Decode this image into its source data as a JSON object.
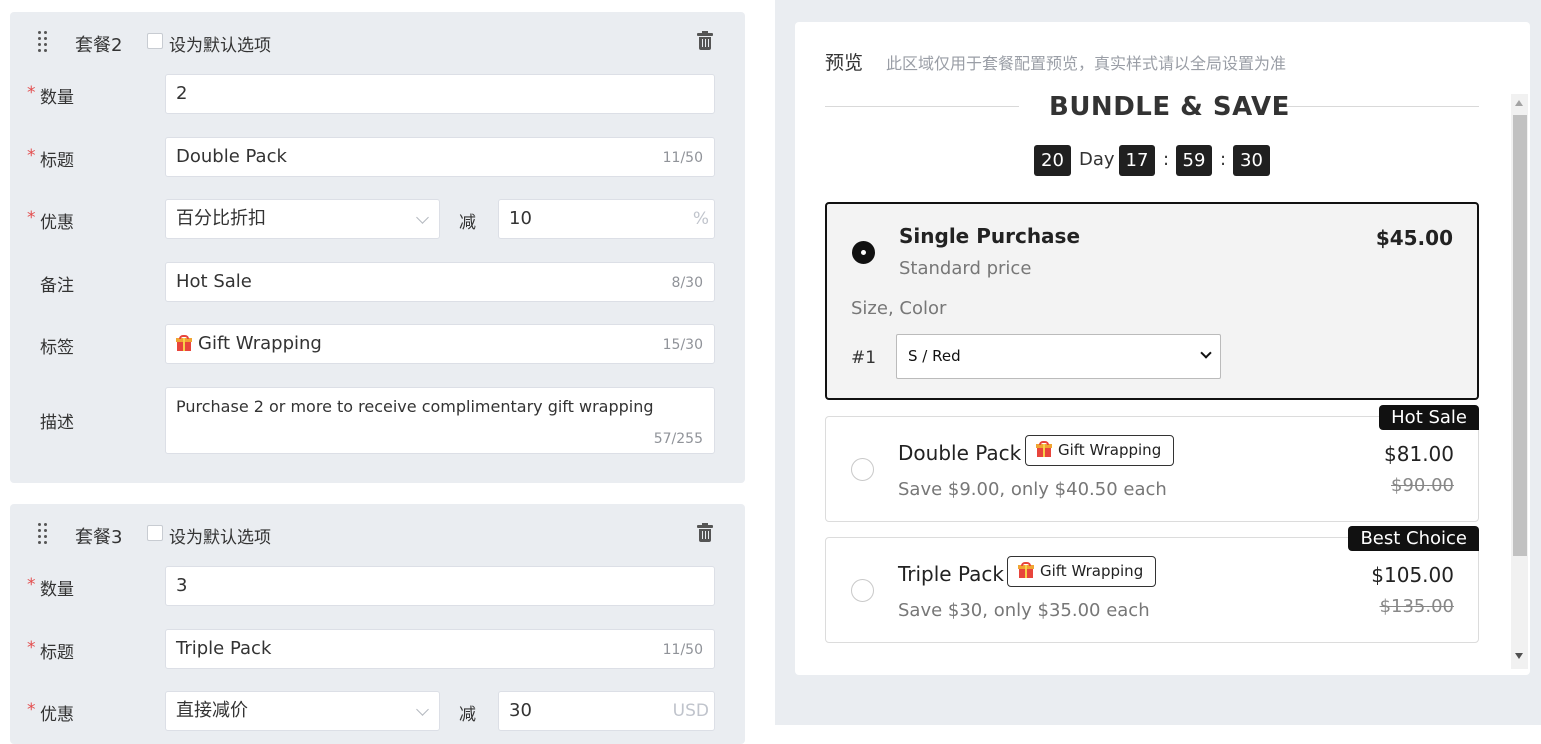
{
  "colors": {
    "required": "#e34d4d",
    "panel": "#eaedf1",
    "accent": "#111111"
  },
  "card2": {
    "title": "套餐2",
    "default_label": "设为默认选项",
    "fields": {
      "quantity": {
        "label": "数量",
        "value": "2"
      },
      "title": {
        "label": "标题",
        "value": "Double Pack",
        "count": "11/50"
      },
      "discount": {
        "label": "优惠",
        "type": "百分比折扣",
        "minus": "减",
        "value": "10",
        "unit": "%"
      },
      "note": {
        "label": "备注",
        "value": "Hot Sale",
        "count": "8/30"
      },
      "tag": {
        "label": "标签",
        "icon": "gift-icon",
        "value": "Gift Wrapping",
        "count": "15/30"
      },
      "desc": {
        "label": "描述",
        "value": "Purchase 2 or more to receive complimentary gift wrapping",
        "count": "57/255"
      }
    }
  },
  "card3": {
    "title": "套餐3",
    "default_label": "设为默认选项",
    "fields": {
      "quantity": {
        "label": "数量",
        "value": "3"
      },
      "title": {
        "label": "标题",
        "value": "Triple Pack",
        "count": "11/50"
      },
      "discount": {
        "label": "优惠",
        "type": "直接减价",
        "minus": "减",
        "value": "30",
        "unit": "USD"
      }
    }
  },
  "preview": {
    "title": "预览",
    "note": "此区域仅用于套餐配置预览，真实样式请以全局设置为准",
    "heading": "BUNDLE & SAVE",
    "timer": {
      "days": "20",
      "day_label": "Day",
      "hours": "17",
      "minutes": "59",
      "seconds": "30",
      "sep": ":"
    },
    "options": [
      {
        "name": "Single Purchase",
        "sub": "Standard price",
        "price": "$45.00",
        "attr_label": "Size, Color",
        "index": "#1",
        "variant": "S / Red",
        "selected": true
      },
      {
        "name": "Double Pack",
        "tag": "Gift Wrapping",
        "sub": "Save $9.00, only $40.50 each",
        "price": "$81.00",
        "old_price": "$90.00",
        "badge": "Hot Sale"
      },
      {
        "name": "Triple Pack",
        "tag": "Gift Wrapping",
        "sub": "Save $30, only $35.00 each",
        "price": "$105.00",
        "old_price": "$135.00",
        "badge": "Best Choice"
      }
    ]
  }
}
